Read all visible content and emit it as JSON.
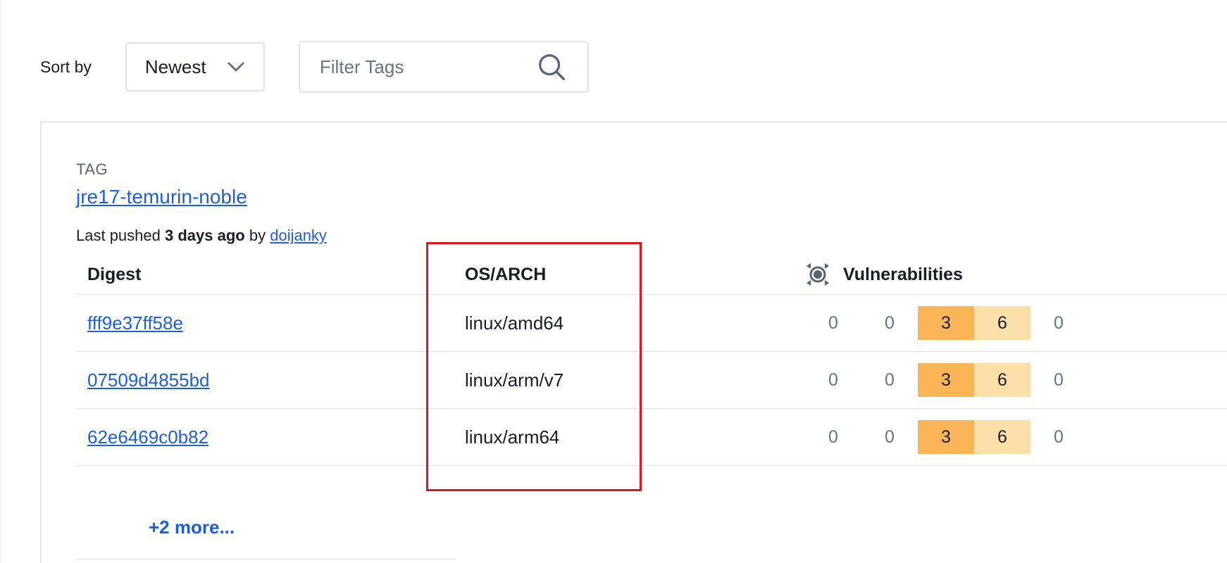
{
  "controls": {
    "sort_label": "Sort by",
    "sort_value": "Newest",
    "filter_placeholder": "Filter Tags"
  },
  "tag": {
    "label": "TAG",
    "name": "jre17-temurin-noble",
    "pushed_prefix": "Last pushed",
    "pushed_when": "3 days ago",
    "pushed_by_word": "by",
    "pushed_by_user": "doijanky"
  },
  "table": {
    "headers": {
      "digest": "Digest",
      "os_arch": "OS/ARCH",
      "vulnerabilities": "Vulnerabilities"
    },
    "rows": [
      {
        "digest": "fff9e37ff58e",
        "os_arch": "linux/amd64",
        "v": [
          "0",
          "0",
          "3",
          "6",
          "0"
        ]
      },
      {
        "digest": "07509d4855bd",
        "os_arch": "linux/arm/v7",
        "v": [
          "0",
          "0",
          "3",
          "6",
          "0"
        ]
      },
      {
        "digest": "62e6469c0b82",
        "os_arch": "linux/arm64",
        "v": [
          "0",
          "0",
          "3",
          "6",
          "0"
        ]
      }
    ],
    "more_link": "+2 more..."
  },
  "colors": {
    "link": "#1f5fd6",
    "high": "#f9b557",
    "medium": "#fde0a9",
    "highlight": "#e0161b"
  }
}
